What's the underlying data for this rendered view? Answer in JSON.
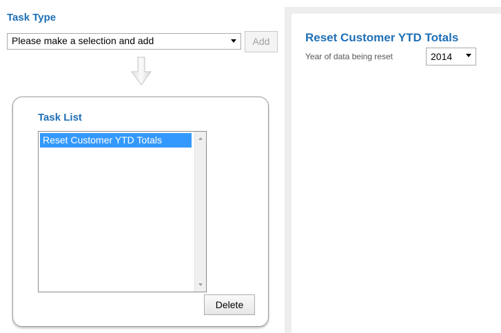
{
  "task_type": {
    "heading": "Task Type",
    "select_value": "Please make a selection and add",
    "add_label": "Add"
  },
  "task_list": {
    "heading": "Task List",
    "items": [
      "Reset Customer YTD Totals"
    ],
    "delete_label": "Delete"
  },
  "detail": {
    "heading": "Reset Customer YTD Totals",
    "year_label": "Year of data being reset",
    "year_value": "2014"
  },
  "colors": {
    "heading_blue": "#1e6fb5",
    "selection_blue": "#3399ff"
  },
  "icons": [
    "down-arrow-icon",
    "chevron-down-icon"
  ]
}
